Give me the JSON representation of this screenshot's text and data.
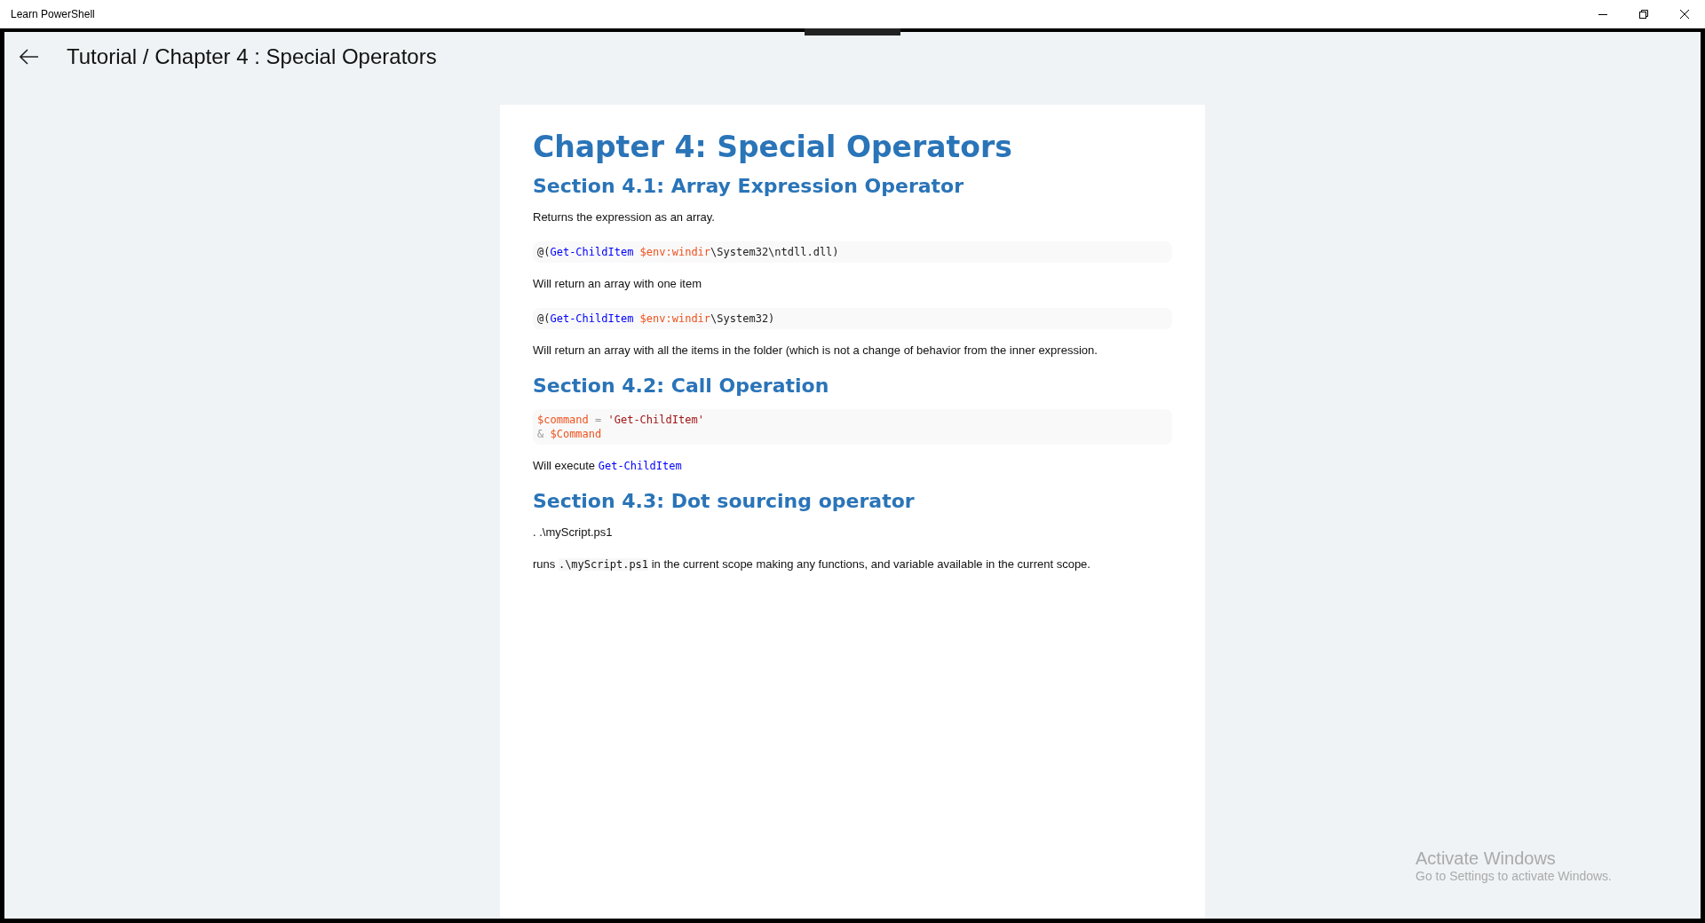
{
  "window": {
    "title": "Learn PowerShell"
  },
  "header": {
    "title": "Tutorial / Chapter 4 :  Special Operators"
  },
  "content": [
    {
      "kind": "h1",
      "text": "Chapter 4: Special Operators"
    },
    {
      "kind": "h2",
      "text": "Section 4.1: Array Expression Operator"
    },
    {
      "kind": "para",
      "parts": [
        {
          "kind": "text",
          "text": "Returns the expression as an array."
        }
      ]
    },
    {
      "kind": "code",
      "lines": [
        [
          {
            "kind": "plain",
            "text": "@("
          },
          {
            "kind": "cmdlet",
            "text": "Get-ChildItem"
          },
          {
            "kind": "variable",
            "text": " $env:windir"
          },
          {
            "kind": "plain",
            "text": "\\System32\\ntdll.dll)"
          }
        ]
      ]
    },
    {
      "kind": "para",
      "parts": [
        {
          "kind": "text",
          "text": "Will return an array with one item"
        }
      ]
    },
    {
      "kind": "code",
      "lines": [
        [
          {
            "kind": "plain",
            "text": "@("
          },
          {
            "kind": "cmdlet",
            "text": "Get-ChildItem"
          },
          {
            "kind": "variable",
            "text": " $env:windir"
          },
          {
            "kind": "plain",
            "text": "\\System32)"
          }
        ]
      ]
    },
    {
      "kind": "para",
      "parts": [
        {
          "kind": "text",
          "text": "Will return an array with all the items in the folder (which is not a change of behavior from the inner expression."
        }
      ]
    },
    {
      "kind": "h2",
      "text": "Section 4.2: Call Operation"
    },
    {
      "kind": "code",
      "lines": [
        [
          {
            "kind": "variable",
            "text": "$command"
          },
          {
            "kind": "operator",
            "text": " = "
          },
          {
            "kind": "string",
            "text": "'Get-ChildItem'"
          }
        ],
        [
          {
            "kind": "operator",
            "text": "& "
          },
          {
            "kind": "variable",
            "text": "$Command"
          }
        ]
      ]
    },
    {
      "kind": "para",
      "parts": [
        {
          "kind": "text",
          "text": "Will execute "
        },
        {
          "kind": "cmdlet",
          "text": "Get-ChildItem"
        }
      ]
    },
    {
      "kind": "h2",
      "text": "Section 4.3: Dot sourcing operator"
    },
    {
      "kind": "para",
      "parts": [
        {
          "kind": "text",
          "text": ". .\\myScript.ps1"
        }
      ]
    },
    {
      "kind": "para",
      "parts": [
        {
          "kind": "text",
          "text": "runs "
        },
        {
          "kind": "inline",
          "text": ".\\myScript.ps1"
        },
        {
          "kind": "text",
          "text": " in the current scope making any functions, and variable available in the current scope."
        }
      ]
    }
  ],
  "activation_notice": {
    "title": "Activate Windows",
    "message": "Go to Settings to activate Windows."
  }
}
